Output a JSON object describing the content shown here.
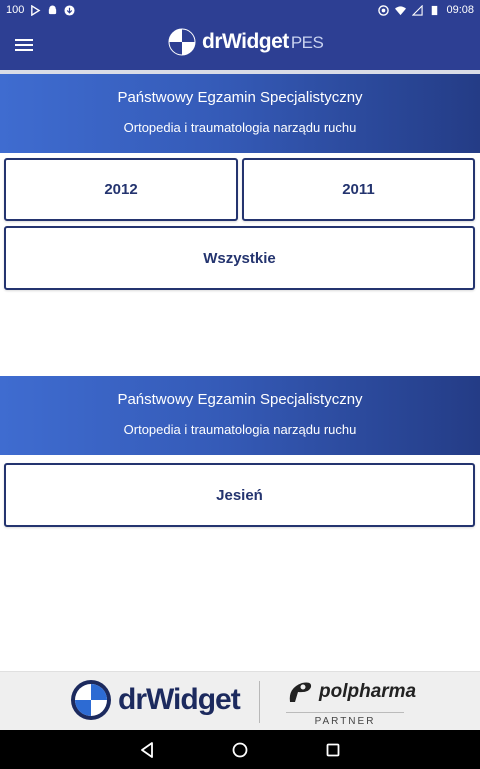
{
  "status_bar": {
    "battery_level_text": "100",
    "time": "09:08"
  },
  "app_bar": {
    "logo_main": "drWidget",
    "logo_suffix": "PES"
  },
  "sections": [
    {
      "banner_title": "Państwowy Egzamin Specjalistyczny",
      "banner_subtitle": "Ortopedia i traumatologia narządu ruchu",
      "buttons": [
        "2012",
        "2011",
        "Wszystkie"
      ]
    },
    {
      "banner_title": "Państwowy Egzamin Specjalistyczny",
      "banner_subtitle": "Ortopedia i traumatologia narządu ruchu",
      "buttons": [
        "Jesień"
      ]
    }
  ],
  "footer": {
    "brand": "drWidget",
    "partner_brand": "polpharma",
    "partner_label": "PARTNER"
  },
  "colors": {
    "primary": "#2d3f93",
    "button_border": "#24346f",
    "banner_start": "#3f6cd0",
    "banner_end": "#243c86"
  }
}
